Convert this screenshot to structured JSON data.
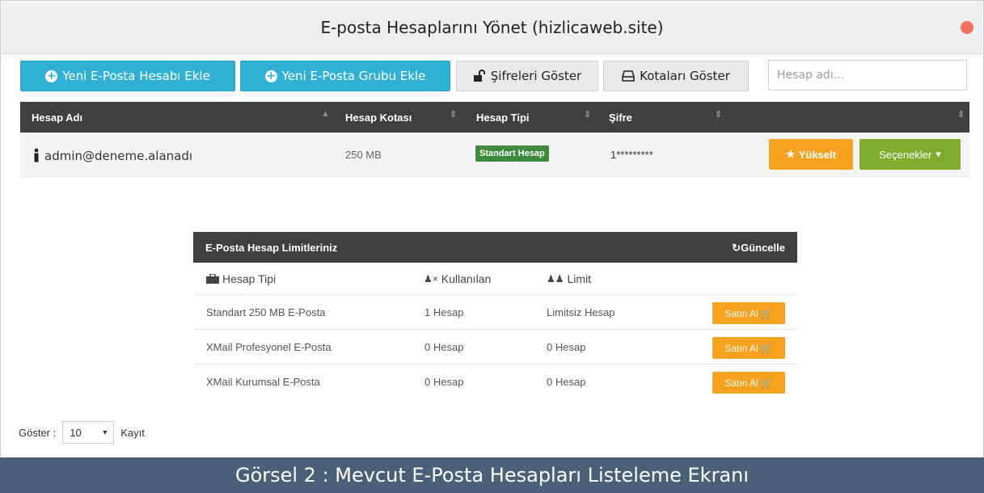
{
  "window": {
    "title": "E-posta Hesaplarını Yönet (hizlicaweb.site)",
    "close_color": "#ef6f62"
  },
  "toolbar": {
    "add_account_label": "Yeni E-Posta Hesabı Ekle",
    "add_group_label": "Yeni E-Posta Grubu Ekle",
    "show_passwords_label": "Şifreleri Göster",
    "show_quotas_label": "Kotaları Göster",
    "search_placeholder": "Hesap adı..."
  },
  "table": {
    "headers": {
      "account": "Hesap Adı",
      "quota": "Hesap Kotası",
      "type": "Hesap Tipi",
      "password": "Şifre"
    },
    "rows": [
      {
        "account": "admin@deneme.alanadı",
        "quota": "250 MB",
        "type": "Standart Hesap",
        "password": "1*********",
        "upgrade_label": "Yükselt",
        "options_label": "Seçenekler"
      }
    ]
  },
  "limits": {
    "title": "E-Posta Hesap Limitleriniz",
    "refresh_label": "Güncelle",
    "headers": {
      "type": "Hesap Tipi",
      "used": "Kullanılan",
      "limit": "Limit"
    },
    "rows": [
      {
        "type": "Standart 250 MB E-Posta",
        "used": "1 Hesap",
        "limit": "Limitsiz Hesap",
        "buy_label": "Satın Al"
      },
      {
        "type": "XMail Profesyonel E-Posta",
        "used": "0 Hesap",
        "limit": "0 Hesap",
        "buy_label": "Satın Al"
      },
      {
        "type": "XMail Kurumsal E-Posta",
        "used": "0 Hesap",
        "limit": "0 Hesap",
        "buy_label": "Satın Al"
      }
    ]
  },
  "footer": {
    "show_label": "Göster :",
    "page_size": "10",
    "records_label": "Kayıt"
  },
  "caption": "Görsel 2 : Mevcut E-Posta Hesapları Listeleme Ekranı",
  "colors": {
    "blue": "#31b0d5",
    "orange": "#f7a21e",
    "green": "#7fac2c",
    "badge_green": "#3d8a3d",
    "dark_header": "#3f3f3f",
    "caption_bg": "#4a6078"
  }
}
